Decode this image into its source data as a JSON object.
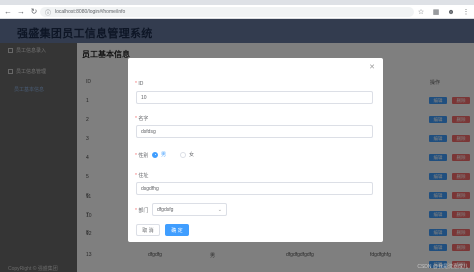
{
  "browser": {
    "url": "localhost:8080/login#/home/info",
    "back_icon": "arrow-left-icon",
    "forward_icon": "arrow-right-icon",
    "reload_icon": "reload-icon"
  },
  "app": {
    "title": "强盛集团员工信息管理系统"
  },
  "sidebar": {
    "items": [
      {
        "label": "员工信息录入"
      },
      {
        "label": "员工信息管理"
      }
    ],
    "sub_items": [
      {
        "label": "员工基本信息"
      }
    ],
    "copyright": "CopyRight © 强盛集团"
  },
  "main": {
    "page_title": "员工基本信息",
    "columns": {
      "id": "ID",
      "operation": "操作"
    },
    "rows": [
      {
        "id": "1"
      },
      {
        "id": "2"
      },
      {
        "id": "3"
      },
      {
        "id": "4"
      },
      {
        "id": "5"
      },
      {
        "id": "6"
      },
      {
        "id": "7"
      },
      {
        "id": "8"
      },
      {
        "id": "10"
      },
      {
        "id": "11"
      },
      {
        "id": "12"
      },
      {
        "id": "13"
      }
    ],
    "edit_label": "编辑",
    "delete_label": "删除",
    "last_row": {
      "name": "dfgdfg",
      "gender": "男",
      "address": "dfgdfgdfgdfg",
      "dept": "fdgdfghfg"
    }
  },
  "modal": {
    "close_icon": "close-icon",
    "id_label": "ID",
    "id_value": "10",
    "name_label": "名字",
    "name_value": "dsfdsg",
    "gender_label": "性别",
    "gender_options": [
      "男",
      "女"
    ],
    "gender_selected": "男",
    "address_label": "住址",
    "address_value": "dsgdfhg",
    "dept_label": "部门",
    "dept_value": "dfgdsfg",
    "cancel_label": "取 消",
    "ok_label": "确 定"
  },
  "watermark": "CSDN @我是沈嘉成儿"
}
